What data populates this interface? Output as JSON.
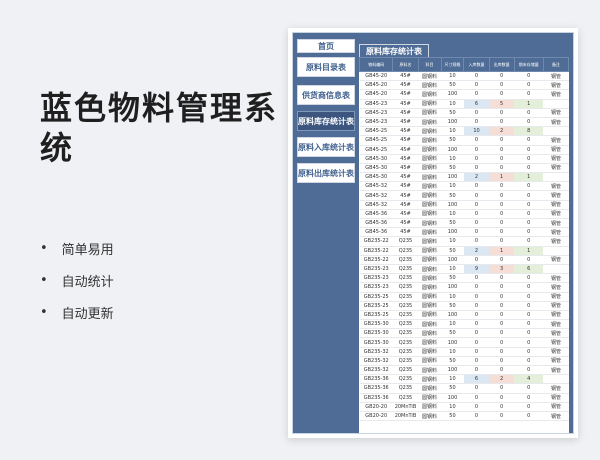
{
  "promo": {
    "title": "蓝色物料管理系统",
    "features": [
      "简单易用",
      "自动统计",
      "自动更新"
    ],
    "bullet": "•"
  },
  "sidebar": {
    "items": [
      {
        "label": "首页"
      },
      {
        "label": "原料目录表"
      },
      {
        "label": "供货商信息表"
      },
      {
        "label": "原料库存统计表",
        "active": true
      },
      {
        "label": "原料入库统计表"
      },
      {
        "label": "原料出库统计表"
      }
    ]
  },
  "sheet": {
    "tab_title": "原料库存统计表",
    "headers": [
      "物料编码",
      "原料名",
      "科目",
      "尺寸规格",
      "入库数量",
      "出库数量",
      "期末存储量",
      "备注"
    ],
    "rows": [
      {
        "code": "GB45-20",
        "name": "45#",
        "cat": "圆钢料",
        "size": "10",
        "in": "0",
        "out": "0",
        "end": "0",
        "note": "钢管"
      },
      {
        "code": "GB45-20",
        "name": "45#",
        "cat": "圆钢料",
        "size": "50",
        "in": "0",
        "out": "0",
        "end": "0",
        "note": "钢管"
      },
      {
        "code": "GB45-20",
        "name": "45#",
        "cat": "圆钢料",
        "size": "100",
        "in": "0",
        "out": "0",
        "end": "0",
        "note": "钢管"
      },
      {
        "code": "GB45-23",
        "name": "45#",
        "cat": "圆钢料",
        "size": "10",
        "in": "6",
        "out": "5",
        "end": "1",
        "note": "",
        "hl": true
      },
      {
        "code": "GB45-23",
        "name": "45#",
        "cat": "圆钢料",
        "size": "50",
        "in": "0",
        "out": "0",
        "end": "0",
        "note": "钢管"
      },
      {
        "code": "GB45-23",
        "name": "45#",
        "cat": "圆钢料",
        "size": "100",
        "in": "0",
        "out": "0",
        "end": "0",
        "note": "钢管"
      },
      {
        "code": "GB45-25",
        "name": "45#",
        "cat": "圆钢料",
        "size": "10",
        "in": "10",
        "out": "2",
        "end": "8",
        "note": "",
        "hl": true
      },
      {
        "code": "GB45-25",
        "name": "45#",
        "cat": "圆钢料",
        "size": "50",
        "in": "0",
        "out": "0",
        "end": "0",
        "note": "钢管"
      },
      {
        "code": "GB45-25",
        "name": "45#",
        "cat": "圆钢料",
        "size": "100",
        "in": "0",
        "out": "0",
        "end": "0",
        "note": "钢管"
      },
      {
        "code": "GB45-30",
        "name": "45#",
        "cat": "圆钢料",
        "size": "10",
        "in": "0",
        "out": "0",
        "end": "0",
        "note": "钢管"
      },
      {
        "code": "GB45-30",
        "name": "45#",
        "cat": "圆钢料",
        "size": "50",
        "in": "0",
        "out": "0",
        "end": "0",
        "note": "钢管"
      },
      {
        "code": "GB45-30",
        "name": "45#",
        "cat": "圆钢料",
        "size": "100",
        "in": "2",
        "out": "1",
        "end": "1",
        "note": "",
        "hl": true
      },
      {
        "code": "GB45-32",
        "name": "45#",
        "cat": "圆钢料",
        "size": "10",
        "in": "0",
        "out": "0",
        "end": "0",
        "note": "钢管"
      },
      {
        "code": "GB45-32",
        "name": "45#",
        "cat": "圆钢料",
        "size": "50",
        "in": "0",
        "out": "0",
        "end": "0",
        "note": "钢管"
      },
      {
        "code": "GB45-32",
        "name": "45#",
        "cat": "圆钢料",
        "size": "100",
        "in": "0",
        "out": "0",
        "end": "0",
        "note": "钢管"
      },
      {
        "code": "GB45-36",
        "name": "45#",
        "cat": "圆钢料",
        "size": "10",
        "in": "0",
        "out": "0",
        "end": "0",
        "note": "钢管"
      },
      {
        "code": "GB45-36",
        "name": "45#",
        "cat": "圆钢料",
        "size": "50",
        "in": "0",
        "out": "0",
        "end": "0",
        "note": "钢管"
      },
      {
        "code": "GB45-36",
        "name": "45#",
        "cat": "圆钢料",
        "size": "100",
        "in": "0",
        "out": "0",
        "end": "0",
        "note": "钢管"
      },
      {
        "code": "GB235-22",
        "name": "Q235",
        "cat": "圆钢料",
        "size": "10",
        "in": "0",
        "out": "0",
        "end": "0",
        "note": "钢管"
      },
      {
        "code": "GB235-22",
        "name": "Q235",
        "cat": "圆钢料",
        "size": "50",
        "in": "2",
        "out": "1",
        "end": "1",
        "note": "",
        "hl": true
      },
      {
        "code": "GB235-22",
        "name": "Q235",
        "cat": "圆钢料",
        "size": "100",
        "in": "0",
        "out": "0",
        "end": "0",
        "note": "钢管"
      },
      {
        "code": "GB235-23",
        "name": "Q235",
        "cat": "圆钢料",
        "size": "10",
        "in": "9",
        "out": "3",
        "end": "6",
        "note": "",
        "hl": true
      },
      {
        "code": "GB235-23",
        "name": "Q235",
        "cat": "圆钢料",
        "size": "50",
        "in": "0",
        "out": "0",
        "end": "0",
        "note": "钢管"
      },
      {
        "code": "GB235-23",
        "name": "Q235",
        "cat": "圆钢料",
        "size": "100",
        "in": "0",
        "out": "0",
        "end": "0",
        "note": "钢管"
      },
      {
        "code": "GB235-25",
        "name": "Q235",
        "cat": "圆钢料",
        "size": "10",
        "in": "0",
        "out": "0",
        "end": "0",
        "note": "钢管"
      },
      {
        "code": "GB235-25",
        "name": "Q235",
        "cat": "圆钢料",
        "size": "50",
        "in": "0",
        "out": "0",
        "end": "0",
        "note": "钢管"
      },
      {
        "code": "GB235-25",
        "name": "Q235",
        "cat": "圆钢料",
        "size": "100",
        "in": "0",
        "out": "0",
        "end": "0",
        "note": "钢管"
      },
      {
        "code": "GB235-30",
        "name": "Q235",
        "cat": "圆钢料",
        "size": "10",
        "in": "0",
        "out": "0",
        "end": "0",
        "note": "钢管"
      },
      {
        "code": "GB235-30",
        "name": "Q235",
        "cat": "圆钢料",
        "size": "50",
        "in": "0",
        "out": "0",
        "end": "0",
        "note": "钢管"
      },
      {
        "code": "GB235-30",
        "name": "Q235",
        "cat": "圆钢料",
        "size": "100",
        "in": "0",
        "out": "0",
        "end": "0",
        "note": "钢管"
      },
      {
        "code": "GB235-32",
        "name": "Q235",
        "cat": "圆钢料",
        "size": "10",
        "in": "0",
        "out": "0",
        "end": "0",
        "note": "钢管"
      },
      {
        "code": "GB235-32",
        "name": "Q235",
        "cat": "圆钢料",
        "size": "50",
        "in": "0",
        "out": "0",
        "end": "0",
        "note": "钢管"
      },
      {
        "code": "GB235-32",
        "name": "Q235",
        "cat": "圆钢料",
        "size": "100",
        "in": "0",
        "out": "0",
        "end": "0",
        "note": "钢管"
      },
      {
        "code": "GB235-36",
        "name": "Q235",
        "cat": "圆钢料",
        "size": "10",
        "in": "6",
        "out": "2",
        "end": "4",
        "note": "",
        "hl": true
      },
      {
        "code": "GB235-36",
        "name": "Q235",
        "cat": "圆钢料",
        "size": "50",
        "in": "0",
        "out": "0",
        "end": "0",
        "note": "钢管"
      },
      {
        "code": "GB235-36",
        "name": "Q235",
        "cat": "圆钢料",
        "size": "100",
        "in": "0",
        "out": "0",
        "end": "0",
        "note": "钢管"
      },
      {
        "code": "GB20-20",
        "name": "20MnTiB",
        "cat": "圆钢料",
        "size": "10",
        "in": "0",
        "out": "0",
        "end": "0",
        "note": "钢管"
      },
      {
        "code": "GB20-20",
        "name": "20MnTiB",
        "cat": "圆钢料",
        "size": "50",
        "in": "0",
        "out": "0",
        "end": "0",
        "note": "钢管"
      }
    ]
  },
  "colors": {
    "accent": "#4e6c95",
    "in_highlight": "#dbe7f3",
    "out_highlight": "#f6ddd5",
    "end_highlight": "#e3efd8"
  }
}
